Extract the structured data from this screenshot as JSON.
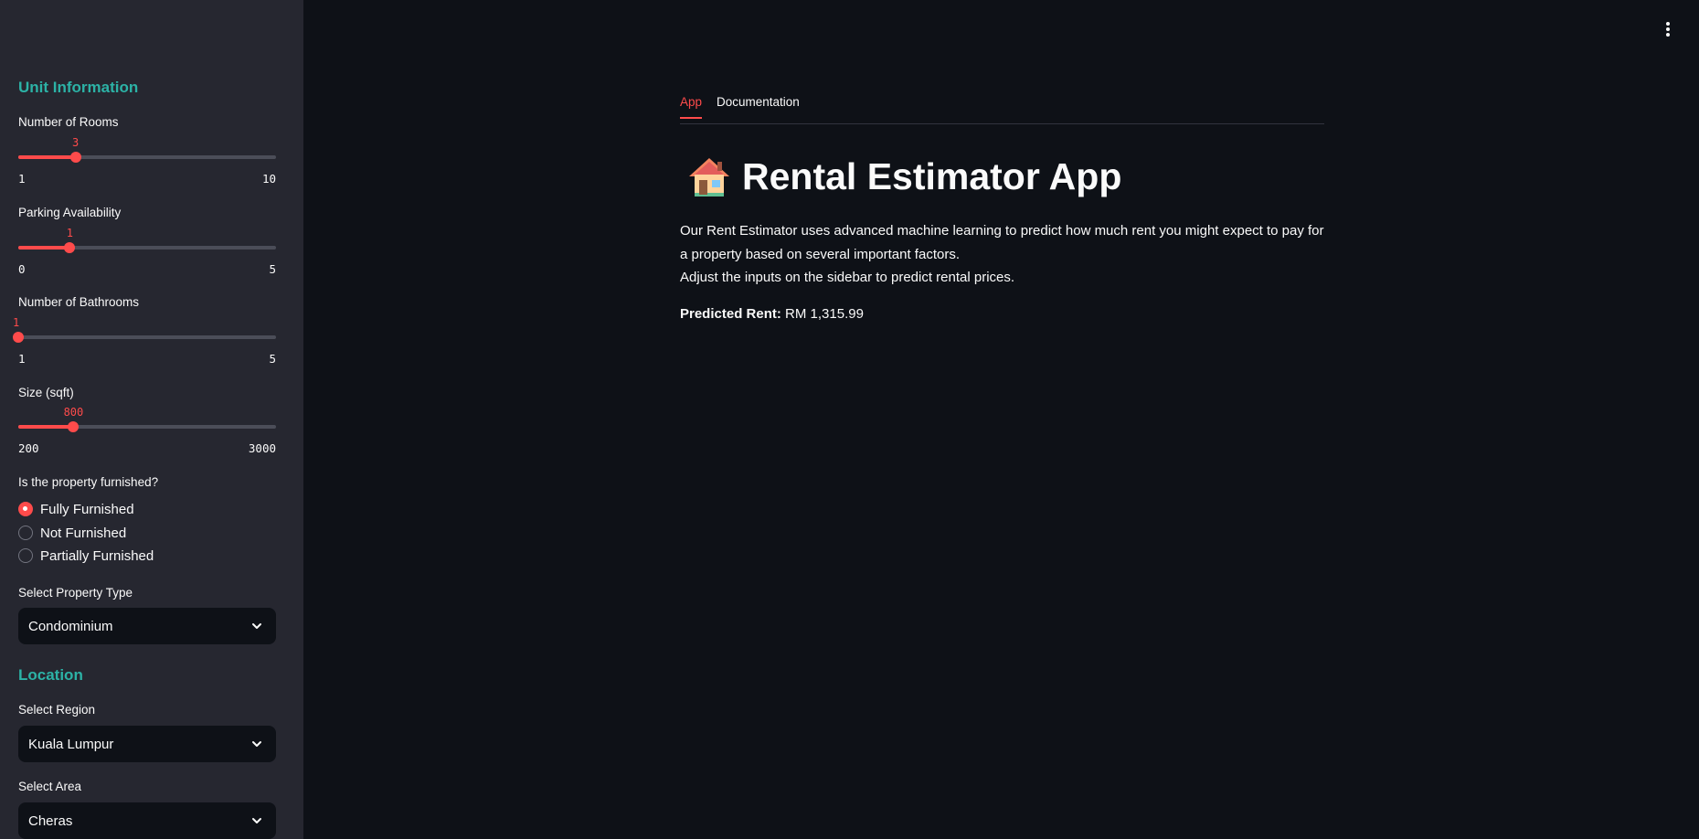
{
  "sidebar": {
    "unit_heading": "Unit Information",
    "sliders": [
      {
        "label": "Number of Rooms",
        "value": 3,
        "min": 1,
        "max": 10,
        "value_text": "3",
        "min_text": "1",
        "max_text": "10"
      },
      {
        "label": "Parking Availability",
        "value": 1,
        "min": 0,
        "max": 5,
        "value_text": "1",
        "min_text": "0",
        "max_text": "5"
      },
      {
        "label": "Number of Bathrooms",
        "value": 1,
        "min": 1,
        "max": 5,
        "value_text": "1",
        "min_text": "1",
        "max_text": "5"
      },
      {
        "label": "Size (sqft)",
        "value": 800,
        "min": 200,
        "max": 3000,
        "value_text": "800",
        "min_text": "200",
        "max_text": "3000"
      }
    ],
    "furnished": {
      "label": "Is the property furnished?",
      "options": [
        "Fully Furnished",
        "Not Furnished",
        "Partially Furnished"
      ],
      "selected": 0
    },
    "property_type": {
      "label": "Select Property Type",
      "value": "Condominium"
    },
    "location_heading": "Location",
    "region": {
      "label": "Select Region",
      "value": "Kuala Lumpur"
    },
    "area": {
      "label": "Select Area",
      "value": "Cheras"
    }
  },
  "main": {
    "tabs": [
      "App",
      "Documentation"
    ],
    "active_tab": 0,
    "title": "Rental Estimator App",
    "title_icon": "house-icon",
    "description_line1": "Our Rent Estimator uses advanced machine learning to predict how much rent you might expect to pay for a property based on several important factors.",
    "description_line2": "Adjust the inputs on the sidebar to predict rental prices.",
    "prediction_label": "Predicted Rent:",
    "prediction_value": "RM 1,315.99"
  },
  "colors": {
    "accent": "#ff4b4b",
    "heading": "#2cb2a6",
    "sidebar_bg": "#262730",
    "main_bg": "#0e1117"
  }
}
